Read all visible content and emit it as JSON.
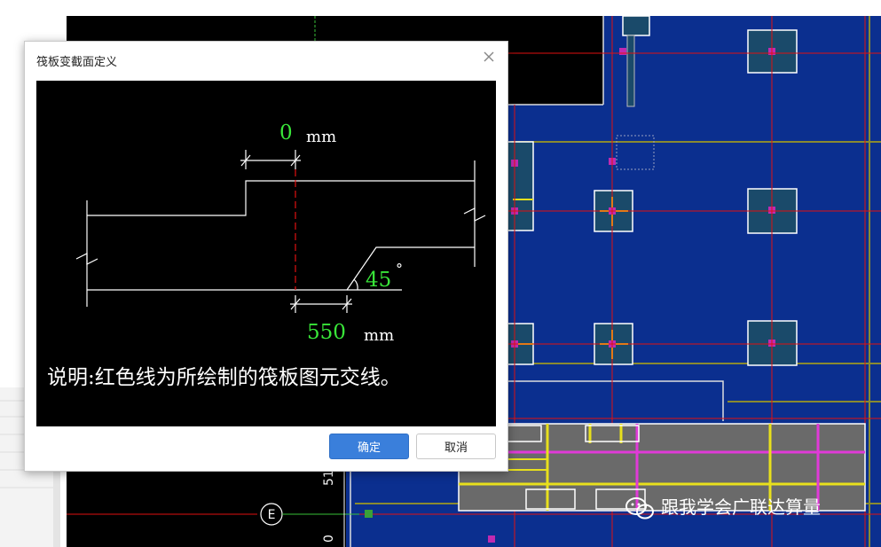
{
  "dialog": {
    "title": "筏板变截面定义",
    "ok_label": "确定",
    "cancel_label": "取消"
  },
  "diagram": {
    "top_offset_value": "0",
    "top_offset_unit": "mm",
    "bottom_offset_value": "550",
    "bottom_offset_unit": "mm",
    "angle_value": "45",
    "angle_unit": "°",
    "note": "说明:红色线为所绘制的筏板图元交线。"
  },
  "background": {
    "axis_label": "E",
    "dim_text_1": "51",
    "dim_text_2": "0"
  },
  "watermark": {
    "text": "跟我学会广联达算量",
    "icon": "wechat-icon"
  },
  "colors": {
    "cad_blue": "#0b2f8f",
    "red_axis": "#e01010",
    "yellow_beam": "#e8e01c",
    "magenta_beam": "#e03ad8",
    "value_green": "#39e639",
    "button_blue": "#3a7fdb"
  }
}
